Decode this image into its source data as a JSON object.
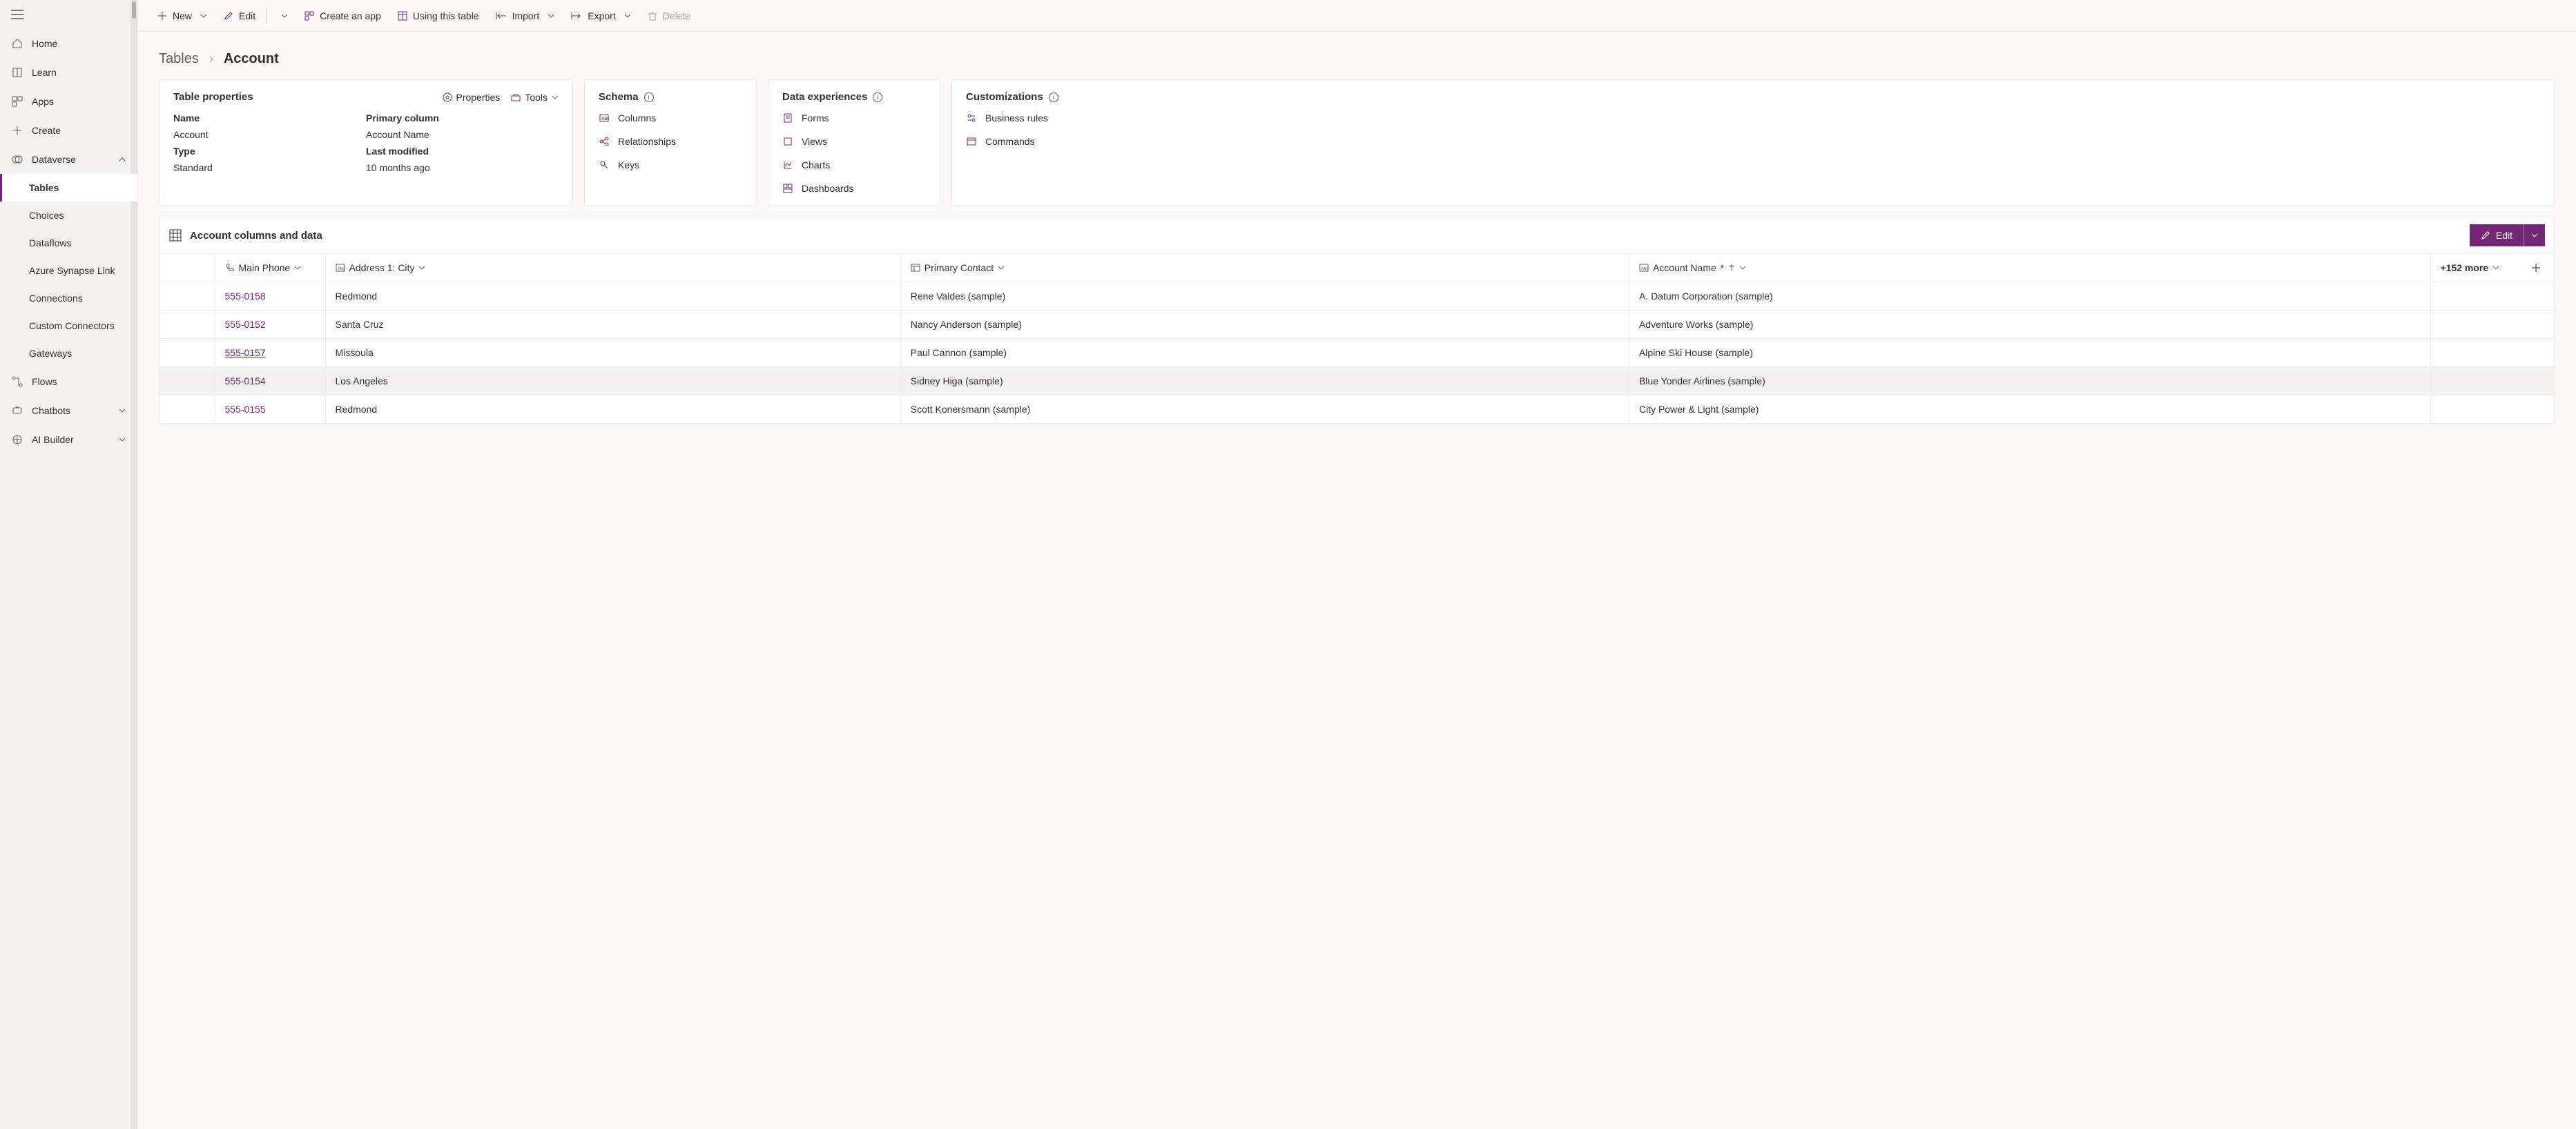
{
  "sidebar": {
    "items": [
      {
        "label": "Home"
      },
      {
        "label": "Learn"
      },
      {
        "label": "Apps"
      },
      {
        "label": "Create"
      },
      {
        "label": "Dataverse"
      }
    ],
    "dataverse_children": [
      {
        "label": "Tables"
      },
      {
        "label": "Choices"
      },
      {
        "label": "Dataflows"
      },
      {
        "label": "Azure Synapse Link"
      },
      {
        "label": "Connections"
      },
      {
        "label": "Custom Connectors"
      },
      {
        "label": "Gateways"
      }
    ],
    "tail": [
      {
        "label": "Flows"
      },
      {
        "label": "Chatbots"
      },
      {
        "label": "AI Builder"
      }
    ]
  },
  "cmdbar": {
    "new": "New",
    "edit": "Edit",
    "create_app": "Create an app",
    "using_table": "Using this table",
    "import": "Import",
    "export": "Export",
    "delete": "Delete"
  },
  "breadcrumb": {
    "parent": "Tables",
    "current": "Account"
  },
  "props": {
    "title": "Table properties",
    "tool_properties": "Properties",
    "tool_tools": "Tools",
    "name_label": "Name",
    "name_value": "Account",
    "pc_label": "Primary column",
    "pc_value": "Account Name",
    "type_label": "Type",
    "type_value": "Standard",
    "lm_label": "Last modified",
    "lm_value": "10 months ago"
  },
  "schema": {
    "title": "Schema",
    "items": [
      "Columns",
      "Relationships",
      "Keys"
    ]
  },
  "experiences": {
    "title": "Data experiences",
    "items": [
      "Forms",
      "Views",
      "Charts",
      "Dashboards"
    ]
  },
  "customizations": {
    "title": "Customizations",
    "items": [
      "Business rules",
      "Commands"
    ]
  },
  "data": {
    "title": "Account columns and data",
    "edit_label": "Edit",
    "more_label": "+152 more",
    "columns": {
      "phone": "Main Phone",
      "city": "Address 1: City",
      "contact": "Primary Contact",
      "account": "Account Name"
    },
    "rows": [
      {
        "phone": "555-0158",
        "city": "Redmond",
        "contact": "Rene Valdes (sample)",
        "account": "A. Datum Corporation (sample)"
      },
      {
        "phone": "555-0152",
        "city": "Santa Cruz",
        "contact": "Nancy Anderson (sample)",
        "account": "Adventure Works (sample)"
      },
      {
        "phone": "555-0157",
        "city": "Missoula",
        "contact": "Paul Cannon (sample)",
        "account": "Alpine Ski House (sample)"
      },
      {
        "phone": "555-0154",
        "city": "Los Angeles",
        "contact": "Sidney Higa (sample)",
        "account": "Blue Yonder Airlines (sample)"
      },
      {
        "phone": "555-0155",
        "city": "Redmond",
        "contact": "Scott Konersmann (sample)",
        "account": "City Power & Light (sample)"
      }
    ]
  }
}
